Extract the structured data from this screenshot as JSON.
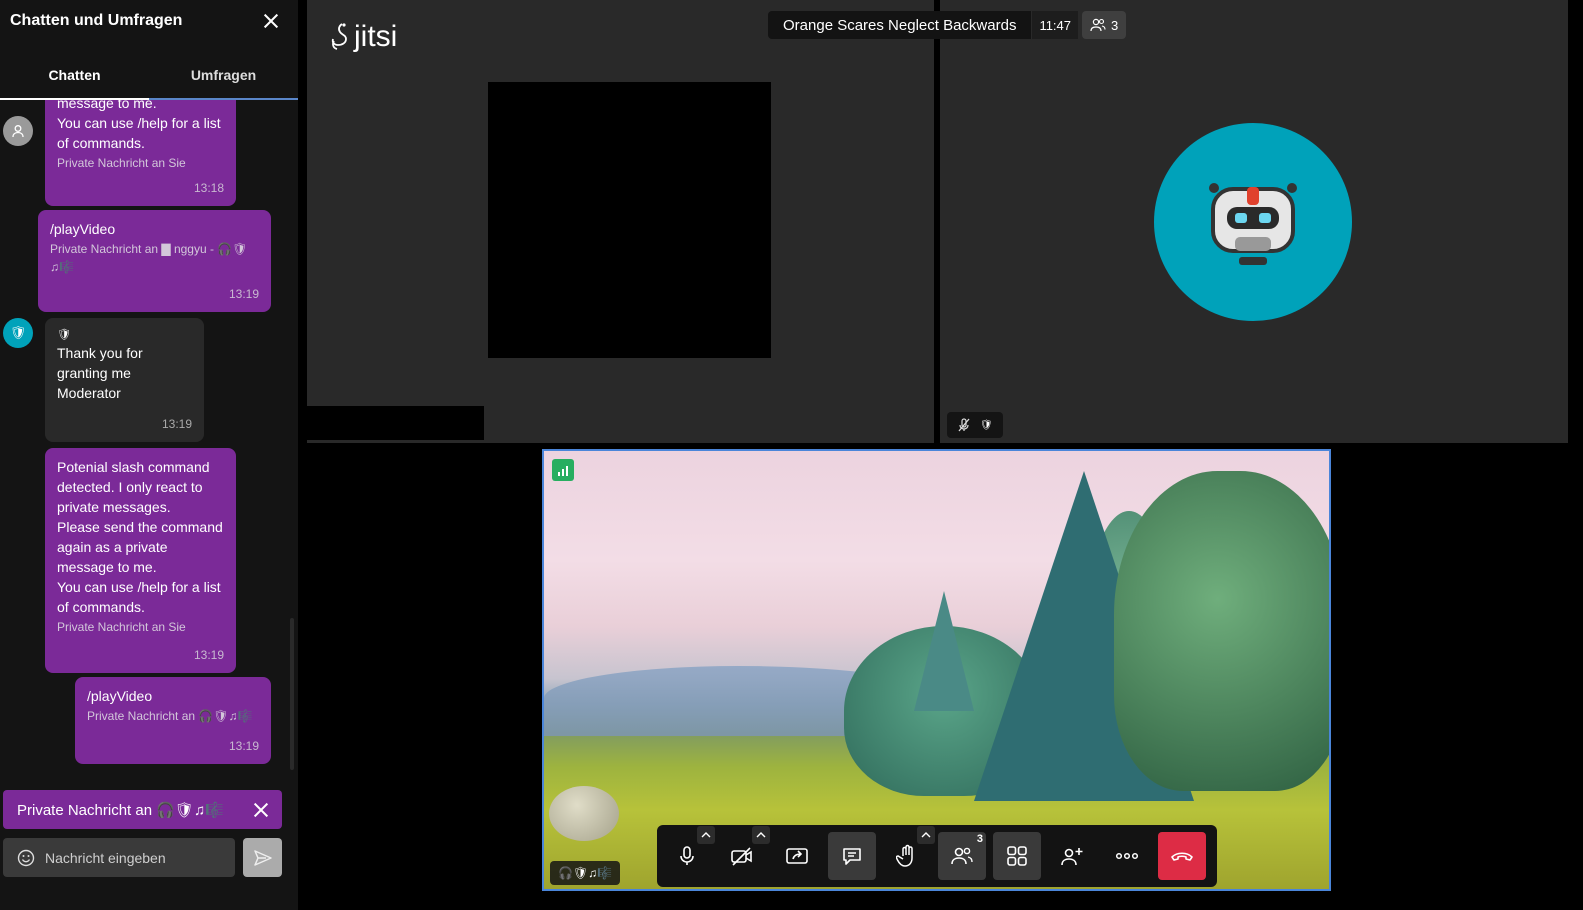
{
  "sidebar": {
    "title": "Chatten und Umfragen",
    "tabs": [
      "Chatten",
      "Umfragen"
    ],
    "messages": [
      {
        "lines": [
          "message to me.",
          "You can use /help for a list",
          "of commands."
        ],
        "meta": "Private Nachricht an Sie",
        "time": "13:18"
      },
      {
        "lines": [
          "/playVideo"
        ],
        "meta": "Private Nachricht an ▇ nggyu - 🎧🛡",
        "meta2": "♫🎼",
        "time": "13:19"
      },
      {
        "sender_icon": "🛡",
        "lines": [
          "Thank you for",
          "granting me",
          "Moderator"
        ],
        "time": "13:19"
      },
      {
        "lines": [
          "Potenial slash command",
          "detected. I only react to",
          "private messages.",
          "Please send the command",
          "again as a private",
          "message to me.",
          "You can use /help for a list",
          "of commands."
        ],
        "meta": "Private Nachricht an Sie",
        "time": "13:19"
      },
      {
        "lines": [
          "/playVideo"
        ],
        "meta": "Private Nachricht an 🎧🛡♫🎼",
        "time": "13:19"
      }
    ],
    "private_bar": "Private Nachricht an 🎧🛡♫🎼",
    "input_placeholder": "Nachricht eingeben"
  },
  "header": {
    "logo": "jitsi",
    "meeting_title": "Orange Scares Neglect Backwards",
    "time": "11:47",
    "participant_count": "3"
  },
  "video": {
    "name_label": "🎧🛡♫🎼"
  },
  "toolbar": {
    "participants_badge": "3"
  },
  "colors": {
    "purple": "#7b2a98",
    "teal": "#00a2ba",
    "hangup": "#dd2c45",
    "accent_blue": "#4a85d9"
  }
}
